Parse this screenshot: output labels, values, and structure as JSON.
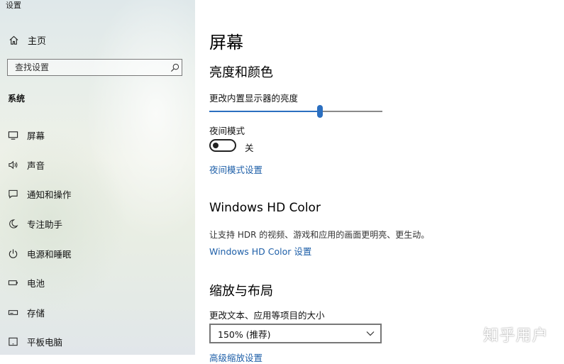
{
  "window": {
    "title": "设置"
  },
  "sidebar": {
    "home_label": "主页",
    "search_placeholder": "查找设置",
    "section_label": "系统",
    "items": [
      {
        "label": "屏幕",
        "icon": "monitor-icon"
      },
      {
        "label": "声音",
        "icon": "speaker-icon"
      },
      {
        "label": "通知和操作",
        "icon": "notification-icon"
      },
      {
        "label": "专注助手",
        "icon": "moon-icon"
      },
      {
        "label": "电源和睡眠",
        "icon": "power-icon"
      },
      {
        "label": "电池",
        "icon": "battery-icon"
      },
      {
        "label": "存储",
        "icon": "storage-icon"
      },
      {
        "label": "平板电脑",
        "icon": "tablet-icon"
      }
    ]
  },
  "main": {
    "page_title": "屏幕",
    "brightness_section": {
      "heading": "亮度和颜色",
      "slider_label": "更改内置显示器的亮度",
      "brightness_fraction": 0.64,
      "night_mode_label": "夜间模式",
      "night_mode_state": "关",
      "night_mode_on": false,
      "night_mode_settings_link": "夜间模式设置"
    },
    "hdr_section": {
      "heading": "Windows HD Color",
      "description": "让支持 HDR 的视频、游戏和应用的画面更明亮、更生动。",
      "settings_link": "Windows HD Color 设置"
    },
    "layout_section": {
      "heading": "缩放与布局",
      "scale_label": "更改文本、应用等项目的大小",
      "scale_value": "150% (推荐)",
      "cut_link": "高级缩放设置"
    }
  },
  "watermark": "知乎用户",
  "colors": {
    "accent": "#2b6fc0",
    "link": "#1e5fa8"
  }
}
